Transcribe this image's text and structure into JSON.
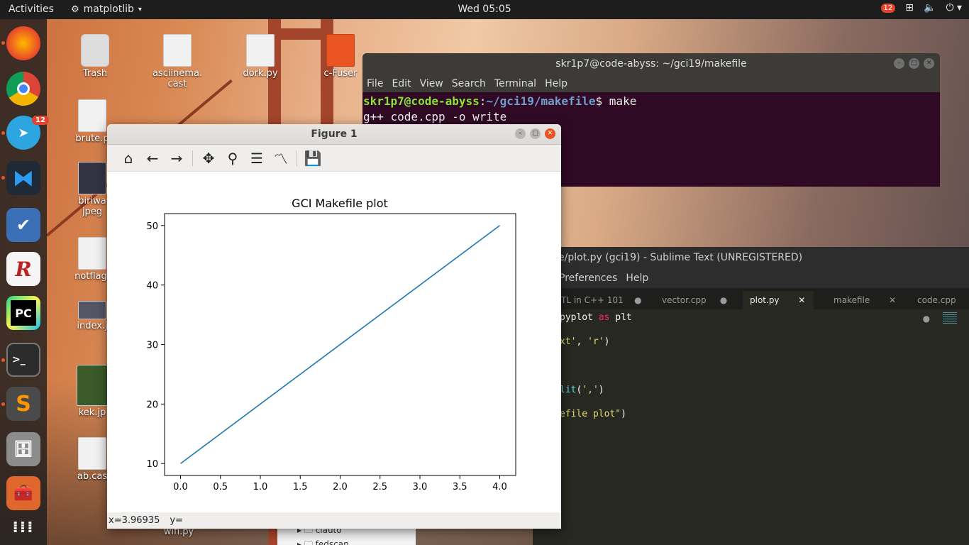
{
  "topbar": {
    "activities": "Activities",
    "app_name": "matplotlib",
    "clock": "Wed 05:05",
    "notification_count": "12"
  },
  "dock": {
    "telegram_badge": "12",
    "items": [
      "firefox",
      "chrome",
      "telegram",
      "vscode",
      "tasks",
      "rstudio",
      "pycharm",
      "terminal",
      "sublime",
      "files",
      "toolbox",
      "show-apps"
    ]
  },
  "desktop_icons": [
    {
      "label": "Trash"
    },
    {
      "label": "asciinema.\ncast"
    },
    {
      "label": "dork.py"
    },
    {
      "label": "c-Fuser"
    },
    {
      "label": "brute.p"
    },
    {
      "label": "biriwa\njpeg"
    },
    {
      "label": "notflag."
    },
    {
      "label": "index.j"
    },
    {
      "label": "kek.jp"
    },
    {
      "label": "ab.cas"
    },
    {
      "label": "wifi.py"
    }
  ],
  "terminal": {
    "title": "skr1p7@code-abyss: ~/gci19/makefile",
    "menu": [
      "File",
      "Edit",
      "View",
      "Search",
      "Terminal",
      "Help"
    ],
    "prompt_user": "skr1p7@code-abyss",
    "prompt_path": "~/gci19/makefile",
    "prompt_cmd": "make",
    "output": "g++ code.cpp -o write"
  },
  "sublime": {
    "title": "e/plot.py (gci19) - Sublime Text (UNREGISTERED)",
    "menu": [
      "Preferences",
      "Help"
    ],
    "tabs": [
      {
        "label": "TL in C++ 101"
      },
      {
        "label": "vector.cpp"
      },
      {
        "label": "plot.py"
      },
      {
        "label": "makefile"
      },
      {
        "label": "code.cpp"
      }
    ],
    "code": {
      "l1_a": "pyplot ",
      "l1_kw": "as",
      "l1_b": " plt",
      "l2_str": "xt'",
      "l2_mid": ", ",
      "l2_str2": "'r'",
      "l2_end": ")",
      "l3_fn": "lit",
      "l3_a": "(",
      "l3_str": "','",
      "l3_end": ")",
      "l4_str": "efile plot\"",
      "l4_end": ")"
    }
  },
  "files": {
    "items": [
      "ciauto",
      "fedscan"
    ]
  },
  "figure": {
    "title": "Figure 1",
    "toolbar": [
      "home-icon",
      "back-icon",
      "forward-icon",
      "pan-icon",
      "zoom-icon",
      "configure-subplots-icon",
      "edit-axes-icon",
      "save-icon"
    ],
    "status_x": "x=3.96935",
    "status_y": "y="
  },
  "chart_data": {
    "type": "line",
    "title": "GCI Makefile plot",
    "xlabel": "",
    "ylabel": "",
    "x": [
      0,
      4
    ],
    "series": [
      {
        "values": [
          10,
          50
        ],
        "color": "#1f77b4"
      }
    ],
    "xlim": [
      -0.2,
      4.2
    ],
    "ylim": [
      8.0,
      52.0
    ],
    "xticks": [
      "0.0",
      "0.5",
      "1.0",
      "1.5",
      "2.0",
      "2.5",
      "3.0",
      "3.5",
      "4.0"
    ],
    "yticks": [
      "10",
      "20",
      "30",
      "40",
      "50"
    ],
    "grid": false
  }
}
